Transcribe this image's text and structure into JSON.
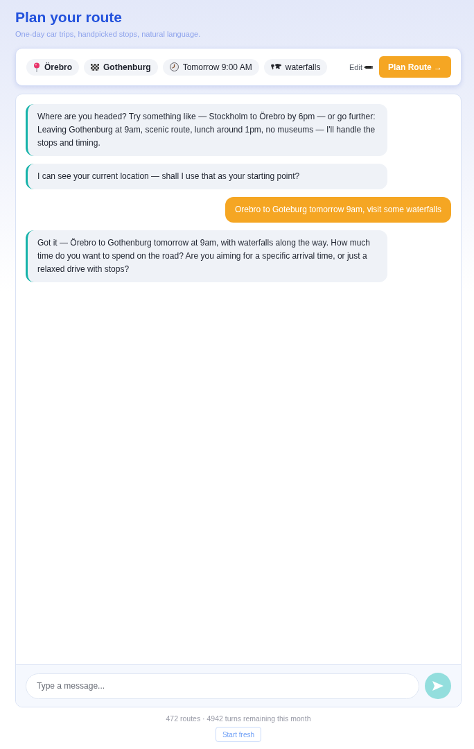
{
  "header": {
    "title": "Plan your route",
    "subtitle": "One-day car trips, handpicked stops, natural language."
  },
  "trip_summary": {
    "chips": [
      {
        "kind": "start",
        "label": "Örebro"
      },
      {
        "kind": "destination",
        "label": "Gothenburg"
      },
      {
        "kind": "time",
        "label": "Tomorrow 9:00 AM"
      },
      {
        "kind": "interest",
        "label": "waterfalls"
      }
    ],
    "edit_label": "Edit",
    "plan_button": "Plan Route →"
  },
  "messages": [
    {
      "kind": "assistant",
      "text": "Where are you headed? Try something like — Stockholm to Örebro by 6pm — or go further: Leaving Gothenburg at 9am, scenic route, lunch around 1pm, no museums — I'll handle the stops and timing."
    },
    {
      "kind": "assistant",
      "text": "I can see your current location — shall I use that as your starting point?"
    },
    {
      "kind": "user",
      "text": "Orebro to Goteburg tomorrow 9am, visit some waterfalls"
    },
    {
      "kind": "assistant",
      "text": "Got it — Örebro to Gothenburg tomorrow at 9am, with waterfalls along the way. How much time do you want to spend on the road? Are you aiming for a specific arrival time, or just a relaxed drive with stops?"
    }
  ],
  "composer": {
    "placeholder": "Type a message...",
    "send_disabled": true
  },
  "footer": {
    "usage": "472 routes · 4942 turns remaining this month",
    "reset_button": "Start fresh"
  }
}
